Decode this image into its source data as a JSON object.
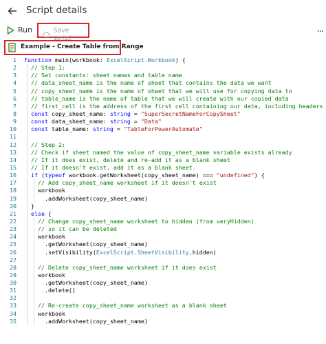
{
  "header": {
    "back_label": "←",
    "title": "Script details"
  },
  "toolbar": {
    "run_label": "Run",
    "save_label": "Save script",
    "more_label": "..."
  },
  "file": {
    "name": "Example - Create Table from Range"
  },
  "colors": {
    "keyword": "#0000ff",
    "comment": "#008000",
    "string": "#a31515",
    "type": "#267f99",
    "line_number": "#237893",
    "highlight": "#d62626",
    "run_icon": "#107c10"
  },
  "code": [
    {
      "n": "1",
      "t": "function main(workbook: ExcelScript.Workbook) {"
    },
    {
      "n": "2",
      "t": "  // Step 1:"
    },
    {
      "n": "3",
      "t": "  // Set constants: sheet names and table name"
    },
    {
      "n": "4",
      "t": "  // data_sheet_name is the name of sheet that contains the data we want"
    },
    {
      "n": "5",
      "t": "  // copy_sheet_name is the name of sheet that we will use for copying data to"
    },
    {
      "n": "6",
      "t": "  // table_name is the name of table that we will create with our copied data"
    },
    {
      "n": "7",
      "t": "  // first_cell is the address of the first cell containing our data, including headers"
    },
    {
      "n": "8",
      "t": "  const copy_sheet_name: string = \"SuperSecretNameForCopySheet\""
    },
    {
      "n": "9",
      "t": "  const data_sheet_name: string = \"Data\""
    },
    {
      "n": "10",
      "t": "  const table_name: string = \"TableForPowerAutomate\""
    },
    {
      "n": "11",
      "t": ""
    },
    {
      "n": "12",
      "t": "  // Step 2:"
    },
    {
      "n": "13",
      "t": "  // Check if sheet named the value of copy_sheet_name variable exists already"
    },
    {
      "n": "14",
      "t": "  // If it does exist, delete and re-add it as a blank sheet"
    },
    {
      "n": "15",
      "t": "  // If it doesn't exist, add it as a blank sheet."
    },
    {
      "n": "16",
      "t": "  if (typeof workbook.getWorksheet(copy_sheet_name) === \"undefined\") {"
    },
    {
      "n": "17",
      "t": "    // Add copy_sheet_name worksheet if it doesn't exist"
    },
    {
      "n": "18",
      "t": "    workbook"
    },
    {
      "n": "19",
      "t": "      .addWorksheet(copy_sheet_name)"
    },
    {
      "n": "20",
      "t": "  }"
    },
    {
      "n": "21",
      "t": "  else {"
    },
    {
      "n": "22",
      "t": "    // Change copy_sheet_name worksheet to hidden (from veryHidden)"
    },
    {
      "n": "23",
      "t": "    // so it can be deleted"
    },
    {
      "n": "24",
      "t": "    workbook"
    },
    {
      "n": "25",
      "t": "      .getWorksheet(copy_sheet_name)"
    },
    {
      "n": "26",
      "t": "      .setVisibility(ExcelScript.SheetVisibility.hidden)"
    },
    {
      "n": "27",
      "t": ""
    },
    {
      "n": "28",
      "t": "    // Delete copy_sheet_name worksheet if it does exist"
    },
    {
      "n": "29",
      "t": "    workbook"
    },
    {
      "n": "30",
      "t": "      .getWorksheet(copy_sheet_name)"
    },
    {
      "n": "31",
      "t": "      .delete()"
    },
    {
      "n": "32",
      "t": ""
    },
    {
      "n": "33",
      "t": "    // Re-create copy_sheet_name worksheet as a blank sheet"
    },
    {
      "n": "34",
      "t": "    workbook"
    },
    {
      "n": "35",
      "t": "      .addWorksheet(copy_sheet_name)"
    }
  ]
}
